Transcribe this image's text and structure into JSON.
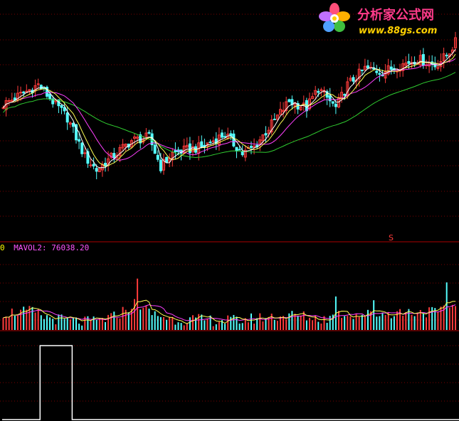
{
  "logo": {
    "name": "分析家公式网",
    "url": "www.88gs.com",
    "name_color": "#ff3b8a",
    "url_color": "#ffd000"
  },
  "sell_marker": "S",
  "volume_label": {
    "prefix": "0",
    "text": "MAVOL2: 76038.20",
    "prefix_color": "#ffff00",
    "text_color": "#ff55ff"
  },
  "colors": {
    "up": "#ff3b3b",
    "down": "#54ffff",
    "grid": "#7a0000",
    "divider": "#aa0000",
    "ma_white": "#ffffff",
    "ma_yellow": "#ffff55",
    "ma_magenta": "#ff40ff",
    "ma_green": "#30cc30",
    "signal": "#ffffff"
  },
  "chart_data": [
    {
      "type": "candlestick",
      "name": "price",
      "series_shape": {
        "count": 156,
        "anchors": [
          [
            0,
            0.6
          ],
          [
            8,
            0.68
          ],
          [
            12,
            0.72
          ],
          [
            16,
            0.64
          ],
          [
            22,
            0.52
          ],
          [
            28,
            0.28
          ],
          [
            32,
            0.2
          ],
          [
            36,
            0.26
          ],
          [
            44,
            0.38
          ],
          [
            50,
            0.4
          ],
          [
            54,
            0.22
          ],
          [
            58,
            0.3
          ],
          [
            62,
            0.32
          ],
          [
            68,
            0.34
          ],
          [
            76,
            0.42
          ],
          [
            82,
            0.3
          ],
          [
            86,
            0.34
          ],
          [
            92,
            0.48
          ],
          [
            98,
            0.62
          ],
          [
            104,
            0.58
          ],
          [
            108,
            0.7
          ],
          [
            114,
            0.58
          ],
          [
            118,
            0.72
          ],
          [
            124,
            0.82
          ],
          [
            130,
            0.8
          ],
          [
            136,
            0.84
          ],
          [
            142,
            0.88
          ],
          [
            148,
            0.84
          ],
          [
            152,
            0.9
          ],
          [
            155,
            0.98
          ]
        ]
      },
      "moving_averages": [
        "white",
        "yellow",
        "magenta",
        "green"
      ]
    },
    {
      "type": "bar",
      "name": "volume",
      "series": [
        {
          "name": "MAVOL2",
          "last": 76038.2
        }
      ],
      "series_shape": {
        "count": 156,
        "anchors": [
          [
            0,
            0.3
          ],
          [
            10,
            0.32
          ],
          [
            14,
            0.22
          ],
          [
            22,
            0.15
          ],
          [
            30,
            0.12
          ],
          [
            38,
            0.22
          ],
          [
            46,
            0.5
          ],
          [
            50,
            0.3
          ],
          [
            58,
            0.18
          ],
          [
            70,
            0.16
          ],
          [
            80,
            0.15
          ],
          [
            90,
            0.22
          ],
          [
            100,
            0.25
          ],
          [
            110,
            0.18
          ],
          [
            116,
            0.28
          ],
          [
            124,
            0.26
          ],
          [
            134,
            0.3
          ],
          [
            144,
            0.32
          ],
          [
            150,
            0.3
          ],
          [
            155,
            0.45
          ]
        ],
        "spikes": [
          [
            46,
            0.95
          ],
          [
            114,
            0.62
          ],
          [
            152,
            0.88
          ],
          [
            127,
            0.55
          ]
        ]
      }
    },
    {
      "type": "line",
      "name": "signal",
      "steps": [
        [
          0,
          0
        ],
        [
          13,
          1
        ],
        [
          24,
          0
        ],
        [
          155,
          0
        ]
      ]
    }
  ]
}
